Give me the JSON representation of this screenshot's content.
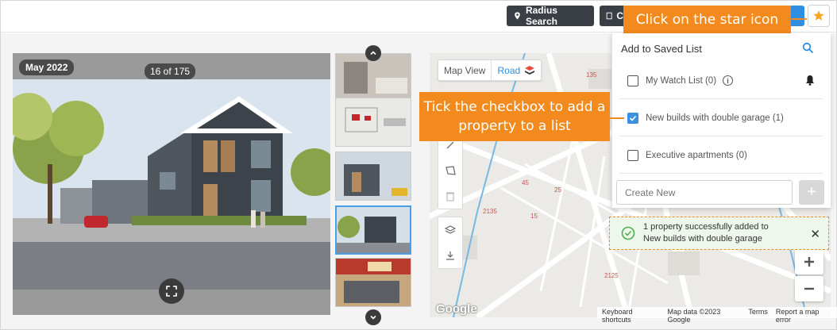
{
  "topbar": {
    "radius_search_label": "Radius Search",
    "second_button_label": "C"
  },
  "callouts": {
    "star": "Click on the star icon",
    "checkbox": "Tick the checkbox to add a property to a list"
  },
  "gallery": {
    "date_badge": "May 2022",
    "counter": "16 of 175"
  },
  "map": {
    "view_label": "Map View",
    "road_label": "Road",
    "google_logo": "Google",
    "attribution": [
      "Keyboard shortcuts",
      "Map data ©2023 Google",
      "Terms",
      "Report a map error"
    ],
    "labels": [
      "45",
      "25",
      "2135",
      "15",
      "2125",
      "135"
    ]
  },
  "saved_list": {
    "title": "Add to Saved List",
    "items": [
      {
        "label": "My Watch List (0)",
        "checked": false
      },
      {
        "label": "New builds with double garage (1)",
        "checked": true
      },
      {
        "label": "Executive apartments (0)",
        "checked": false
      }
    ],
    "create_placeholder": "Create New",
    "add_symbol": "+"
  },
  "toast": {
    "line1": "1 property successfully added to",
    "line2": "New builds with double garage",
    "close": "✕"
  },
  "colors": {
    "accent": "#f28a1e",
    "primary": "#2f8ee0",
    "dark_button": "#3a3f46",
    "success_bg": "#eef7ec"
  }
}
